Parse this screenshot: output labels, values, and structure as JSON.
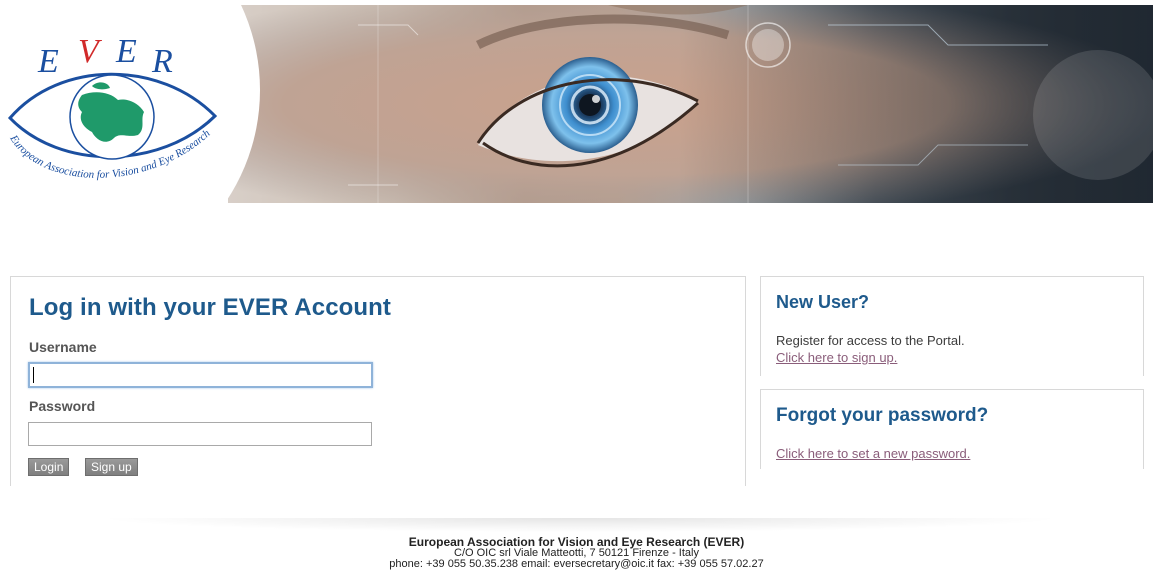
{
  "header": {
    "logo_text": "EVER",
    "logo_ring_text": "European Association for Vision and Eye Research"
  },
  "login": {
    "title": "Log in with your EVER Account",
    "username_label": "Username",
    "username_value": "",
    "password_label": "Password",
    "password_value": "",
    "login_button": "Login",
    "signup_button": "Sign up"
  },
  "new_user": {
    "title": "New User?",
    "text": "Register for access to the Portal.",
    "link": "Click here to sign up."
  },
  "forgot": {
    "title": "Forgot your password?",
    "link": "Click here to set a new password."
  },
  "footer": {
    "org": "European Association for Vision and Eye Research (EVER)",
    "address": "C/O OIC srl Viale Matteotti, 7 50121 Firenze - Italy",
    "contact": "phone: +39 055 50.35.238 email: eversecretary@oic.it fax: +39 055 57.02.27"
  },
  "colors": {
    "title_blue": "#1e5a8c",
    "link_purple": "#8a5d7a",
    "logo_blue": "#1b4fa0",
    "logo_red": "#d12a2a",
    "logo_green": "#1f9a6a"
  }
}
